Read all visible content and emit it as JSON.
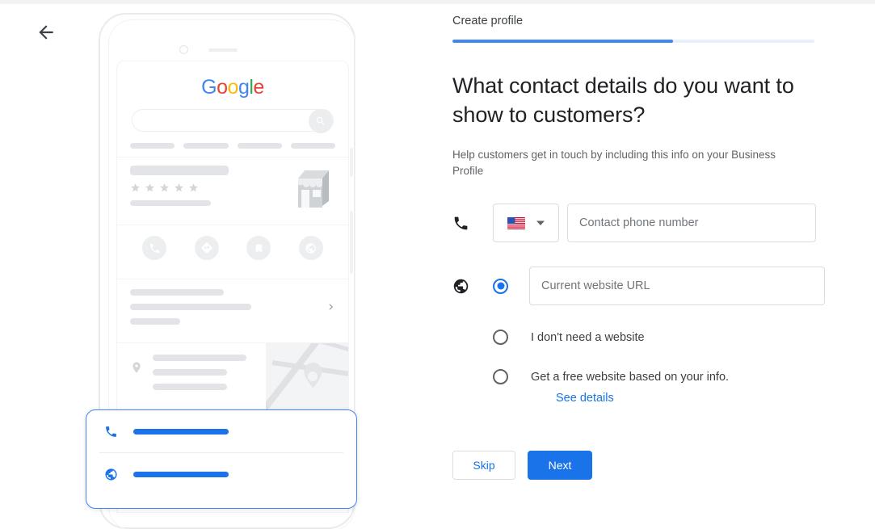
{
  "colors": {
    "accent_blue": "#1a73e8",
    "progress_blue": "#4285F4",
    "progress_track": "#e8f0fe",
    "text_primary": "#202124",
    "text_secondary": "#5f6368",
    "border": "#dadce0",
    "placeholder": "#70757a"
  },
  "nav": {
    "back_icon": "arrow-left-icon"
  },
  "panel": {
    "kicker": "Create profile",
    "progress_percent": 61,
    "headline": "What contact details do you want to show to customers?",
    "subtext": "Help customers get in touch by including this info on your Business Profile"
  },
  "phone_row": {
    "lead_icon": "phone-icon",
    "country_code_selector": {
      "flag": "us-flag-icon",
      "country": "United States",
      "chevron": "chevron-down-icon"
    },
    "phone_input": {
      "placeholder": "Contact phone number",
      "value": ""
    }
  },
  "website_section": {
    "lead_icon": "globe-icon",
    "options": [
      {
        "id": "current-website",
        "selected": true,
        "type": "input",
        "placeholder": "Current website URL",
        "value": ""
      },
      {
        "id": "no-website",
        "selected": false,
        "type": "label",
        "label": "I don't need a website"
      },
      {
        "id": "free-website",
        "selected": false,
        "type": "label",
        "label": "Get a free website based on your info.",
        "link": "See details"
      }
    ]
  },
  "buttons": {
    "skip": "Skip",
    "next": "Next"
  },
  "phone_mockup": {
    "logo": {
      "letters": [
        "G",
        "o",
        "o",
        "g",
        "l",
        "e"
      ]
    },
    "search_icon": "magnifier-icon",
    "action_icons": [
      "phone-icon",
      "directions-icon",
      "bookmark-icon",
      "globe-icon"
    ],
    "storefront_icon": "storefront-icon",
    "rating_stars": 5,
    "location_icon": "map-pin-icon",
    "clock_icon": "clock-icon",
    "chevron_icon": "chevron-right-icon",
    "callout": {
      "rows": [
        {
          "icon": "phone-icon"
        },
        {
          "icon": "globe-icon"
        }
      ]
    }
  }
}
